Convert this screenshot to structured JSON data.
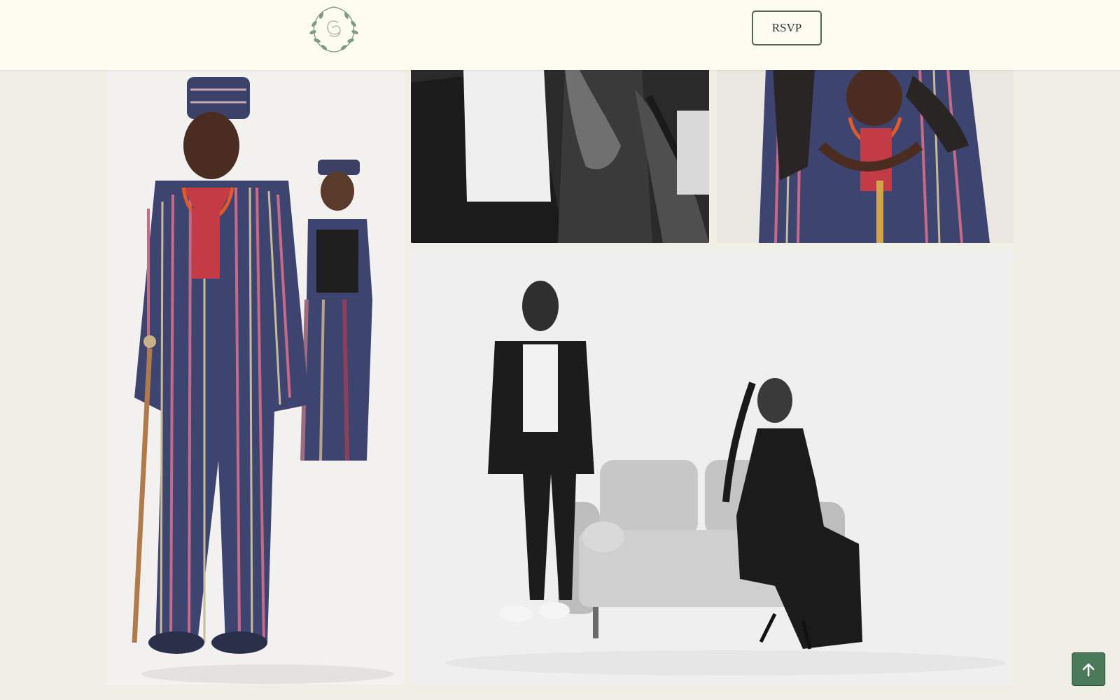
{
  "header": {
    "logo_icon": "monogram-wreath-icon",
    "rsvp_label": "RSVP"
  },
  "gallery": {
    "photos": [
      {
        "name": "photo-couple-traditional-attire",
        "icon": "photo"
      },
      {
        "name": "photo-couple-black-and-white-closeup",
        "icon": "photo"
      },
      {
        "name": "photo-couple-traditional-embrace",
        "icon": "photo"
      },
      {
        "name": "photo-couple-sofa-black-and-white",
        "icon": "photo"
      }
    ]
  },
  "back_to_top": {
    "icon": "arrow-up-icon"
  },
  "colors": {
    "header_bg": "#fefbf0",
    "page_bg": "#efefe6",
    "accent": "#4a7a5a",
    "button_border": "#4f6b5a"
  }
}
